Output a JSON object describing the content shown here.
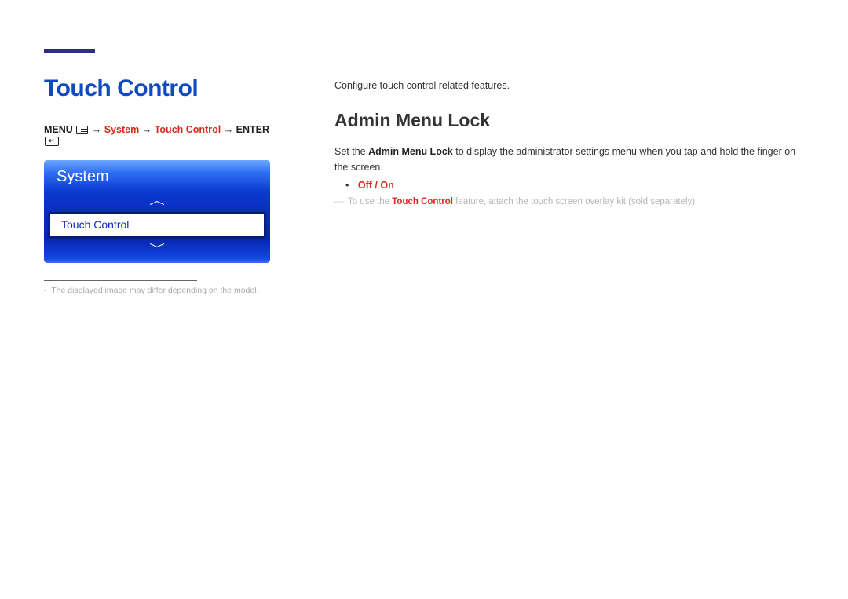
{
  "left": {
    "title": "Touch Control",
    "nav": {
      "menu_label": "MENU",
      "arrow": " → ",
      "system": "System",
      "touch": "Touch Control",
      "enter_label": "ENTER"
    },
    "osd": {
      "header": "System",
      "selected": "Touch Control"
    },
    "footnote": "The displayed image may differ depending on the model."
  },
  "right": {
    "intro": "Configure touch control related features.",
    "subtitle": "Admin Menu Lock",
    "desc_prefix": "Set the ",
    "desc_bold": "Admin Menu Lock",
    "desc_suffix": " to display the administrator settings menu when you tap and hold the finger on the screen.",
    "option_off": "Off",
    "option_sep": " / ",
    "option_on": "On",
    "note_prefix": "To use the ",
    "note_bold": "Touch Control",
    "note_suffix": " feature, attach the touch screen overlay kit (sold separately)."
  }
}
